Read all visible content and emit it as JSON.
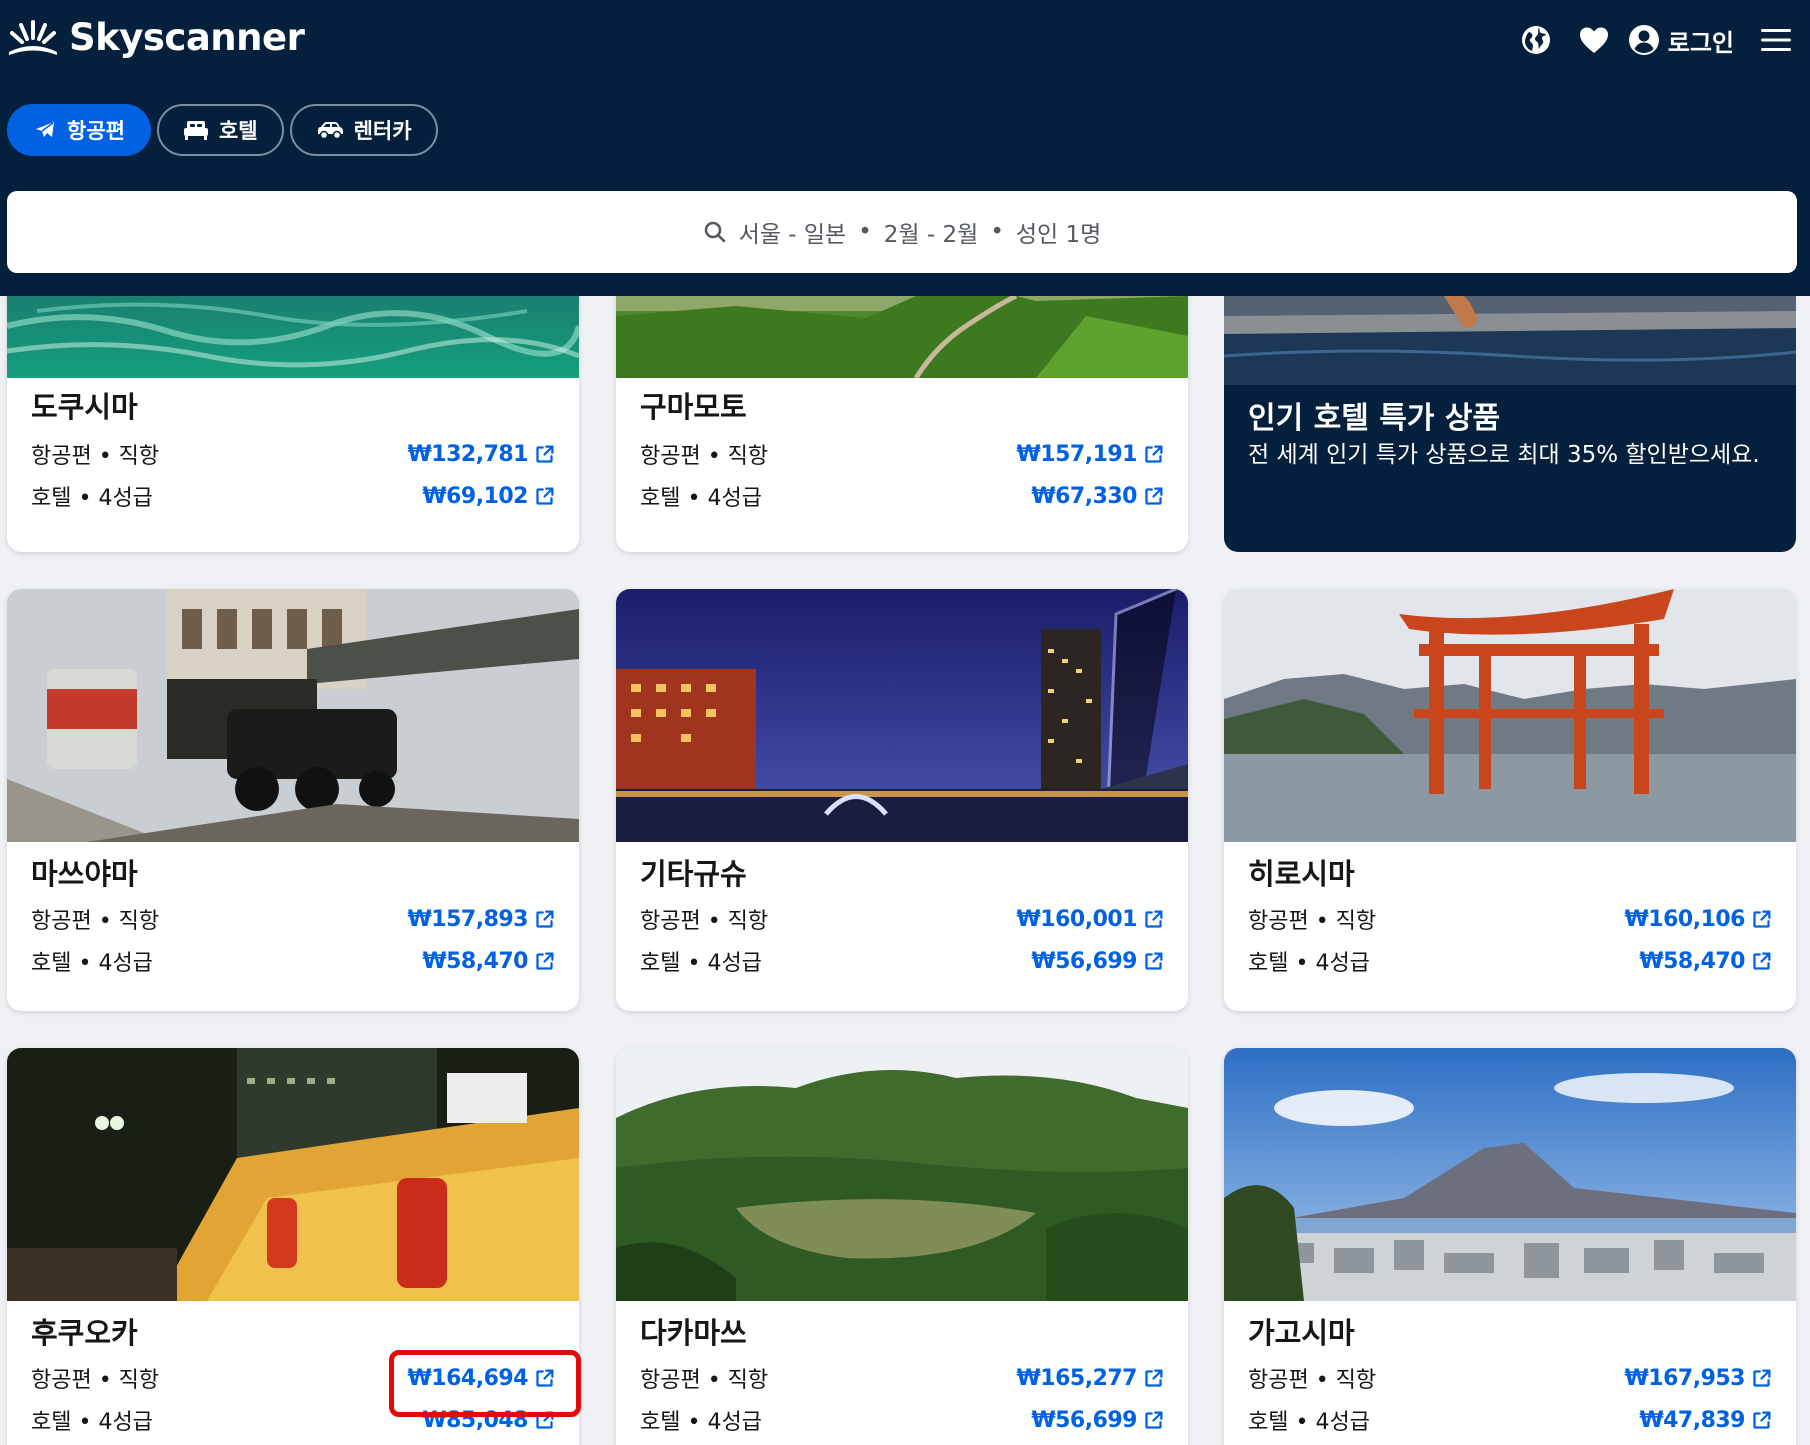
{
  "header": {
    "brand": "Skyscanner",
    "login_label": "로그인",
    "tabs": [
      {
        "label": "항공편",
        "icon": "plane-icon",
        "active": true
      },
      {
        "label": "호텔",
        "icon": "bed-icon",
        "active": false
      },
      {
        "label": "렌터카",
        "icon": "car-icon",
        "active": false
      }
    ]
  },
  "search": {
    "route": "서울 - 일본",
    "dates": "2월 - 2월",
    "travelers": "성인 1명",
    "separator": "•"
  },
  "promo": {
    "title": "인기 호텔 특가 상품",
    "description": "전 세계 인기 특가 상품으로 최대 35% 할인받으세요."
  },
  "labels": {
    "flight": "항공편 • 직항",
    "hotel": "호텔 • 4성급"
  },
  "cards": [
    {
      "city": "도쿠시마",
      "flight_price": "₩132,781",
      "hotel_price": "₩69,102"
    },
    {
      "city": "구마모토",
      "flight_price": "₩157,191",
      "hotel_price": "₩67,330"
    },
    {
      "city": "마쓰야마",
      "flight_price": "₩157,893",
      "hotel_price": "₩58,470"
    },
    {
      "city": "기타규슈",
      "flight_price": "₩160,001",
      "hotel_price": "₩56,699"
    },
    {
      "city": "히로시마",
      "flight_price": "₩160,106",
      "hotel_price": "₩58,470"
    },
    {
      "city": "후쿠오카",
      "flight_price": "₩164,694",
      "hotel_price": "₩85,048"
    },
    {
      "city": "다카마쓰",
      "flight_price": "₩165,277",
      "hotel_price": "₩56,699"
    },
    {
      "city": "가고시마",
      "flight_price": "₩167,953",
      "hotel_price": "₩47,839"
    }
  ],
  "colors": {
    "header_bg": "#05203c",
    "accent": "#0062e3",
    "highlight": "#e00b0b"
  }
}
